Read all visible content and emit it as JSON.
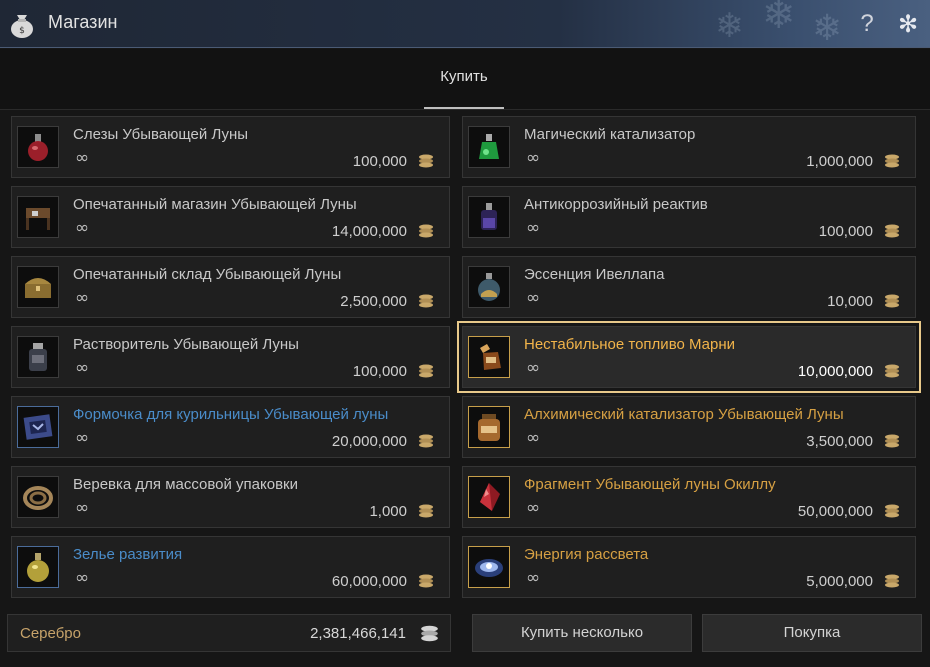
{
  "window": {
    "title": "Магазин"
  },
  "tabs": [
    {
      "label": "Купить"
    }
  ],
  "items": [
    {
      "name": "Слезы Убывающей Луны",
      "quantity": "∞",
      "price": "100,000",
      "icon": "tear-bottle-icon",
      "color": "normal"
    },
    {
      "name": "Магический катализатор",
      "quantity": "∞",
      "price": "1,000,000",
      "icon": "green-potion-icon",
      "color": "normal"
    },
    {
      "name": "Опечатанный магазин Убывающей Луны",
      "quantity": "∞",
      "price": "14,000,000",
      "icon": "shop-stand-icon",
      "color": "normal"
    },
    {
      "name": "Антикоррозийный реактив",
      "quantity": "∞",
      "price": "100,000",
      "icon": "purple-vial-icon",
      "color": "normal"
    },
    {
      "name": "Опечатанный склад Убывающей Луны",
      "quantity": "∞",
      "price": "2,500,000",
      "icon": "storage-chest-icon",
      "color": "normal"
    },
    {
      "name": "Эссенция Ивеллапа",
      "quantity": "∞",
      "price": "10,000",
      "icon": "essence-flask-icon",
      "color": "normal"
    },
    {
      "name": "Растворитель Убывающей Луны",
      "quantity": "∞",
      "price": "100,000",
      "icon": "solvent-jar-icon",
      "color": "normal"
    },
    {
      "name": "Нестабильное топливо Марни",
      "quantity": "∞",
      "price": "10,000,000",
      "icon": "fuel-flask-icon",
      "color": "gold-bright",
      "selected": true
    },
    {
      "name": "Формочка для курильницы Убывающей луны",
      "quantity": "∞",
      "price": "20,000,000",
      "icon": "incense-mold-icon",
      "color": "blue"
    },
    {
      "name": "Алхимический катализатор Убывающей Луны",
      "quantity": "∞",
      "price": "3,500,000",
      "icon": "catalyst-jar-icon",
      "color": "gold"
    },
    {
      "name": "Веревка для массовой упаковки",
      "quantity": "∞",
      "price": "1,000",
      "icon": "rope-coil-icon",
      "color": "normal"
    },
    {
      "name": "Фрагмент Убывающей луны Окиллу",
      "quantity": "∞",
      "price": "50,000,000",
      "icon": "red-crystal-icon",
      "color": "gold"
    },
    {
      "name": "Зелье развития",
      "quantity": "∞",
      "price": "60,000,000",
      "icon": "growth-potion-icon",
      "color": "blue"
    },
    {
      "name": "Энергия рассвета",
      "quantity": "∞",
      "price": "5,000,000",
      "icon": "dawn-energy-icon",
      "color": "gold"
    }
  ],
  "footer": {
    "silver_label": "Серебро",
    "silver_value": "2,381,466,141",
    "buy_multiple_label": "Купить несколько",
    "purchase_label": "Покупка"
  },
  "colors": {
    "normal_name": "#c8c8c8",
    "blue_name": "#4a8cc9",
    "gold_name": "#d6a043",
    "selected_outline": "#e8c98a"
  }
}
